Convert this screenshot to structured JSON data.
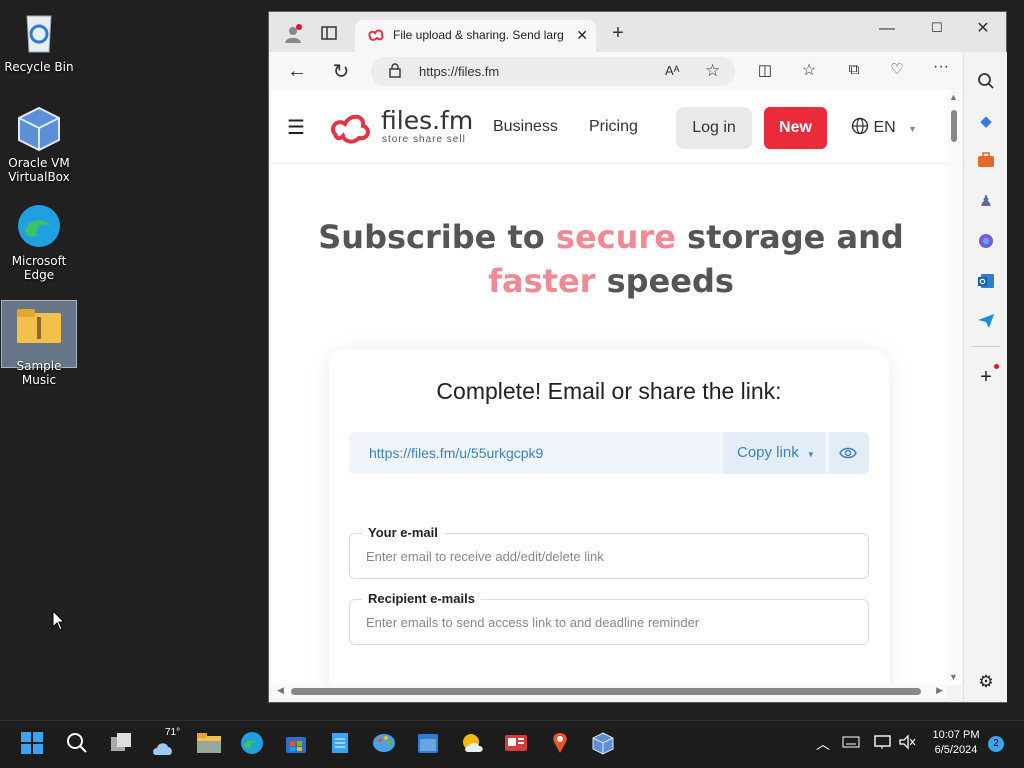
{
  "desktop": {
    "icons": [
      {
        "label": "Recycle Bin",
        "icon": "recycle-bin-icon"
      },
      {
        "label": "Oracle VM VirtualBox",
        "icon": "virtualbox-icon"
      },
      {
        "label": "Microsoft Edge",
        "icon": "edge-icon"
      },
      {
        "label": "Sample Music",
        "icon": "zip-folder-icon"
      }
    ]
  },
  "browser": {
    "tab_title": "File upload & sharing. Send larg",
    "address": "https://files.fm"
  },
  "site": {
    "brand": "files.fm",
    "tagline": "store share sell",
    "nav": {
      "business": "Business",
      "pricing": "Pricing",
      "login": "Log in",
      "new": "New",
      "language": "EN"
    },
    "hero": {
      "part1": "Subscribe to ",
      "highlight1": "secure",
      "part2": " storage and",
      "highlight2": "faster",
      "part3": " speeds"
    },
    "card": {
      "title": "Complete! Email or share the link:",
      "share_url": "https://files.fm/u/55urkgcpk9",
      "copy_label": "Copy link",
      "email_label": "Your e-mail",
      "email_placeholder": "Enter email to receive add/edit/delete link",
      "recipients_label": "Recipient e-mails",
      "recipients_placeholder": "Enter emails to send access link to and deadline reminder"
    }
  },
  "taskbar": {
    "weather_temp": "71°",
    "time": "10:07 PM",
    "date": "6/5/2024",
    "notifications": "2"
  },
  "colors": {
    "accent_red": "#eb2a3c",
    "hero_pink": "#f08b95",
    "link_blue": "#3b82c4"
  }
}
